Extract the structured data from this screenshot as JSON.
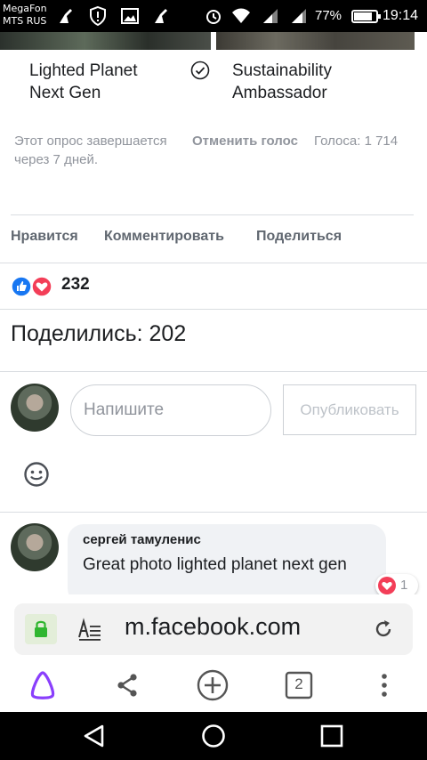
{
  "status_bar": {
    "carrier_line1": "MegaFon",
    "carrier_line2": "MTS RUS",
    "battery_percent": "77%",
    "time": "19:14"
  },
  "poll": {
    "options": [
      {
        "label_line1": "Lighted Planet",
        "label_line2": "Next Gen",
        "selected": false
      },
      {
        "label_line1": "Sustainability",
        "label_line2": "Ambassador",
        "selected": true
      }
    ],
    "ends_text": "Этот опрос завершается через 7 дней.",
    "undo_vote_label": "Отменить голос",
    "votes_label": "Голоса: 1 714"
  },
  "actions": {
    "like": "Нравится",
    "comment": "Комментировать",
    "share": "Поделиться"
  },
  "reactions": {
    "count": "232",
    "types": [
      "like",
      "love"
    ]
  },
  "shares": {
    "text": "Поделились: 202"
  },
  "comment_composer": {
    "placeholder": "Напишите",
    "publish_label": "Опубликовать"
  },
  "comments": [
    {
      "author": "сергей тамуленис",
      "text": "Great photo lighted planet next gen",
      "reaction_count": "1"
    }
  ],
  "browser": {
    "url": "m.facebook.com",
    "tab_count": "2"
  },
  "colors": {
    "facebook_blue": "#1877f2",
    "love_red": "#f33e58",
    "alice_purple": "#8a3ffc",
    "lock_green": "#2fb62f"
  }
}
